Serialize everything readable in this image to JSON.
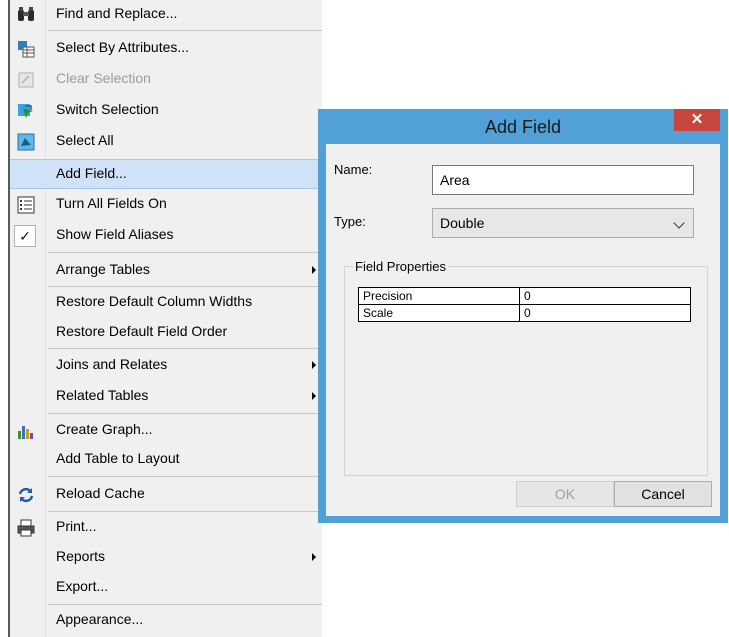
{
  "menu": {
    "items": [
      {
        "label": "Find and Replace...",
        "icon": "binoculars-icon",
        "state": "normal"
      },
      {
        "label": "Select By Attributes...",
        "icon": "select-by-attributes-icon",
        "state": "normal"
      },
      {
        "label": "Clear Selection",
        "icon": "clear-selection-icon",
        "state": "disabled"
      },
      {
        "label": "Switch Selection",
        "icon": "switch-selection-icon",
        "state": "normal"
      },
      {
        "label": "Select All",
        "icon": "select-all-icon",
        "state": "normal"
      },
      {
        "label": "Add Field...",
        "icon": "",
        "state": "hover"
      },
      {
        "label": "Turn All Fields On",
        "icon": "field-list-icon",
        "state": "normal"
      },
      {
        "label": "Show Field Aliases",
        "icon": "checkmark-icon",
        "state": "checked"
      },
      {
        "label": "Arrange Tables",
        "icon": "",
        "state": "submenu"
      },
      {
        "label": "Restore Default Column Widths",
        "icon": "",
        "state": "normal"
      },
      {
        "label": "Restore Default Field Order",
        "icon": "",
        "state": "normal"
      },
      {
        "label": "Joins and Relates",
        "icon": "",
        "state": "submenu"
      },
      {
        "label": "Related Tables",
        "icon": "",
        "state": "submenu"
      },
      {
        "label": "Create Graph...",
        "icon": "bar-graph-icon",
        "state": "normal"
      },
      {
        "label": "Add Table to Layout",
        "icon": "",
        "state": "normal"
      },
      {
        "label": "Reload Cache",
        "icon": "reload-icon",
        "state": "normal"
      },
      {
        "label": "Print...",
        "icon": "printer-icon",
        "state": "normal"
      },
      {
        "label": "Reports",
        "icon": "",
        "state": "submenu"
      },
      {
        "label": "Export...",
        "icon": "",
        "state": "normal"
      },
      {
        "label": "Appearance...",
        "icon": "",
        "state": "normal"
      }
    ]
  },
  "dialog": {
    "title": "Add Field",
    "close_glyph": "✕",
    "name_label": "Name:",
    "name_value": "Area",
    "type_label": "Type:",
    "type_value": "Double",
    "group_title": "Field Properties",
    "properties": [
      {
        "key": "Precision",
        "value": "0"
      },
      {
        "key": "Scale",
        "value": "0"
      }
    ],
    "ok_label": "OK",
    "cancel_label": "Cancel"
  },
  "colors": {
    "dialog_frame": "#52a0d8",
    "close_button": "#c7463d",
    "menu_highlight": "#cfe2f7"
  }
}
